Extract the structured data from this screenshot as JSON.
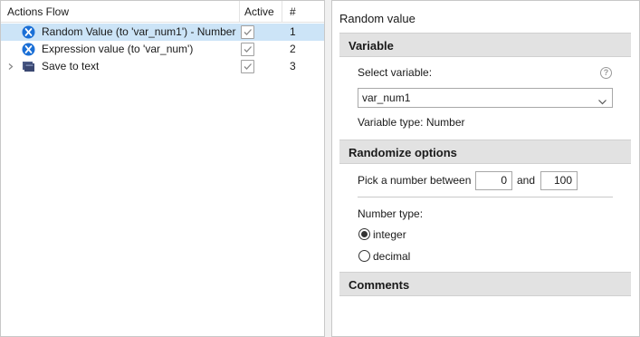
{
  "flow": {
    "header": {
      "name": "Actions Flow",
      "active": "Active",
      "num": "#"
    },
    "rows": [
      {
        "label": "Random Value (to 'var_num1') - Number",
        "num": "1",
        "icon": "variable-x-icon",
        "selected": true
      },
      {
        "label": "Expression value (to 'var_num')",
        "num": "2",
        "icon": "variable-x-icon",
        "selected": false
      },
      {
        "label": "Save to text",
        "num": "3",
        "icon": "save-to-text-icon",
        "selected": false
      }
    ]
  },
  "panel": {
    "title": "Random value",
    "variable": {
      "header": "Variable",
      "select_label": "Select variable:",
      "help": "?",
      "selected": "var_num1",
      "type_label": "Variable type: Number"
    },
    "randomize": {
      "header": "Randomize options",
      "between_label": "Pick a number between",
      "min": "0",
      "and_label": "and",
      "max": "100",
      "number_type_label": "Number type:",
      "integer_label": "integer",
      "decimal_label": "decimal",
      "selected_type": "integer"
    },
    "comments": {
      "header": "Comments"
    }
  },
  "colors": {
    "selection": "#cce4f7",
    "section_header": "#e2e2e2",
    "icon_blue": "#1a6fd6"
  }
}
